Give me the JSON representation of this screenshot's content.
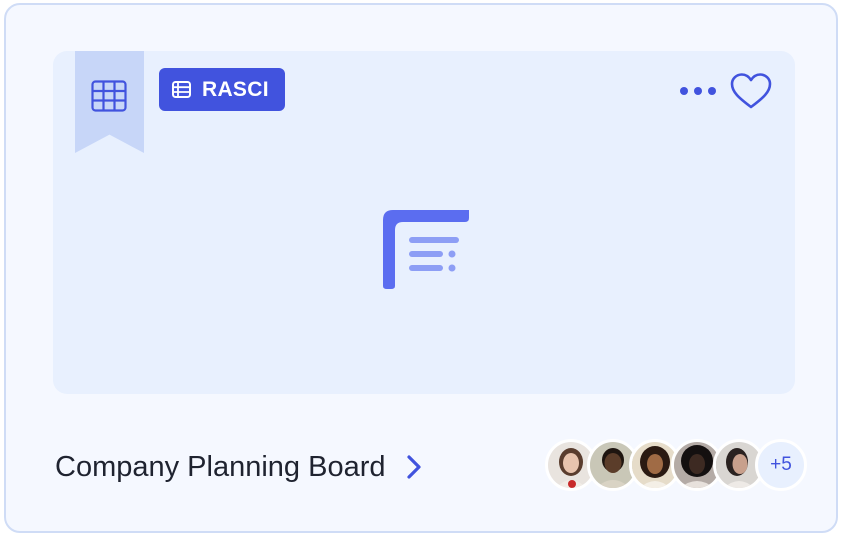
{
  "card": {
    "badge_label": "RASCI",
    "title": "Company Planning Board",
    "extra_members_label": "+5"
  },
  "icons": {
    "ribbon": "table-grid-icon",
    "badge": "list-table-icon",
    "more": "more-horizontal-icon",
    "favorite": "heart-outline-icon",
    "preview": "document-list-icon",
    "title_link": "chevron-right-icon"
  },
  "members": [
    {
      "name": "member-1",
      "skin": "#e8c4ae",
      "hair": "#5a3d2e",
      "bg": "#e9e4df"
    },
    {
      "name": "member-2",
      "skin": "#5b3d2a",
      "hair": "#1e1510",
      "bg": "#c9c7b7"
    },
    {
      "name": "member-3",
      "skin": "#a06b45",
      "hair": "#2b1a12",
      "bg": "#e6dcc9"
    },
    {
      "name": "member-4",
      "skin": "#3d2a22",
      "hair": "#141010",
      "bg": "#b4aba6"
    },
    {
      "name": "member-5",
      "skin": "#c8a08c",
      "hair": "#2a2220",
      "bg": "#d9d6d2"
    }
  ],
  "colors": {
    "accent": "#4153de",
    "card_bg": "#f5f8ff",
    "preview_bg": "#e8f0fe",
    "ribbon_bg": "#c7d6f8",
    "title_text": "#1f2330"
  }
}
